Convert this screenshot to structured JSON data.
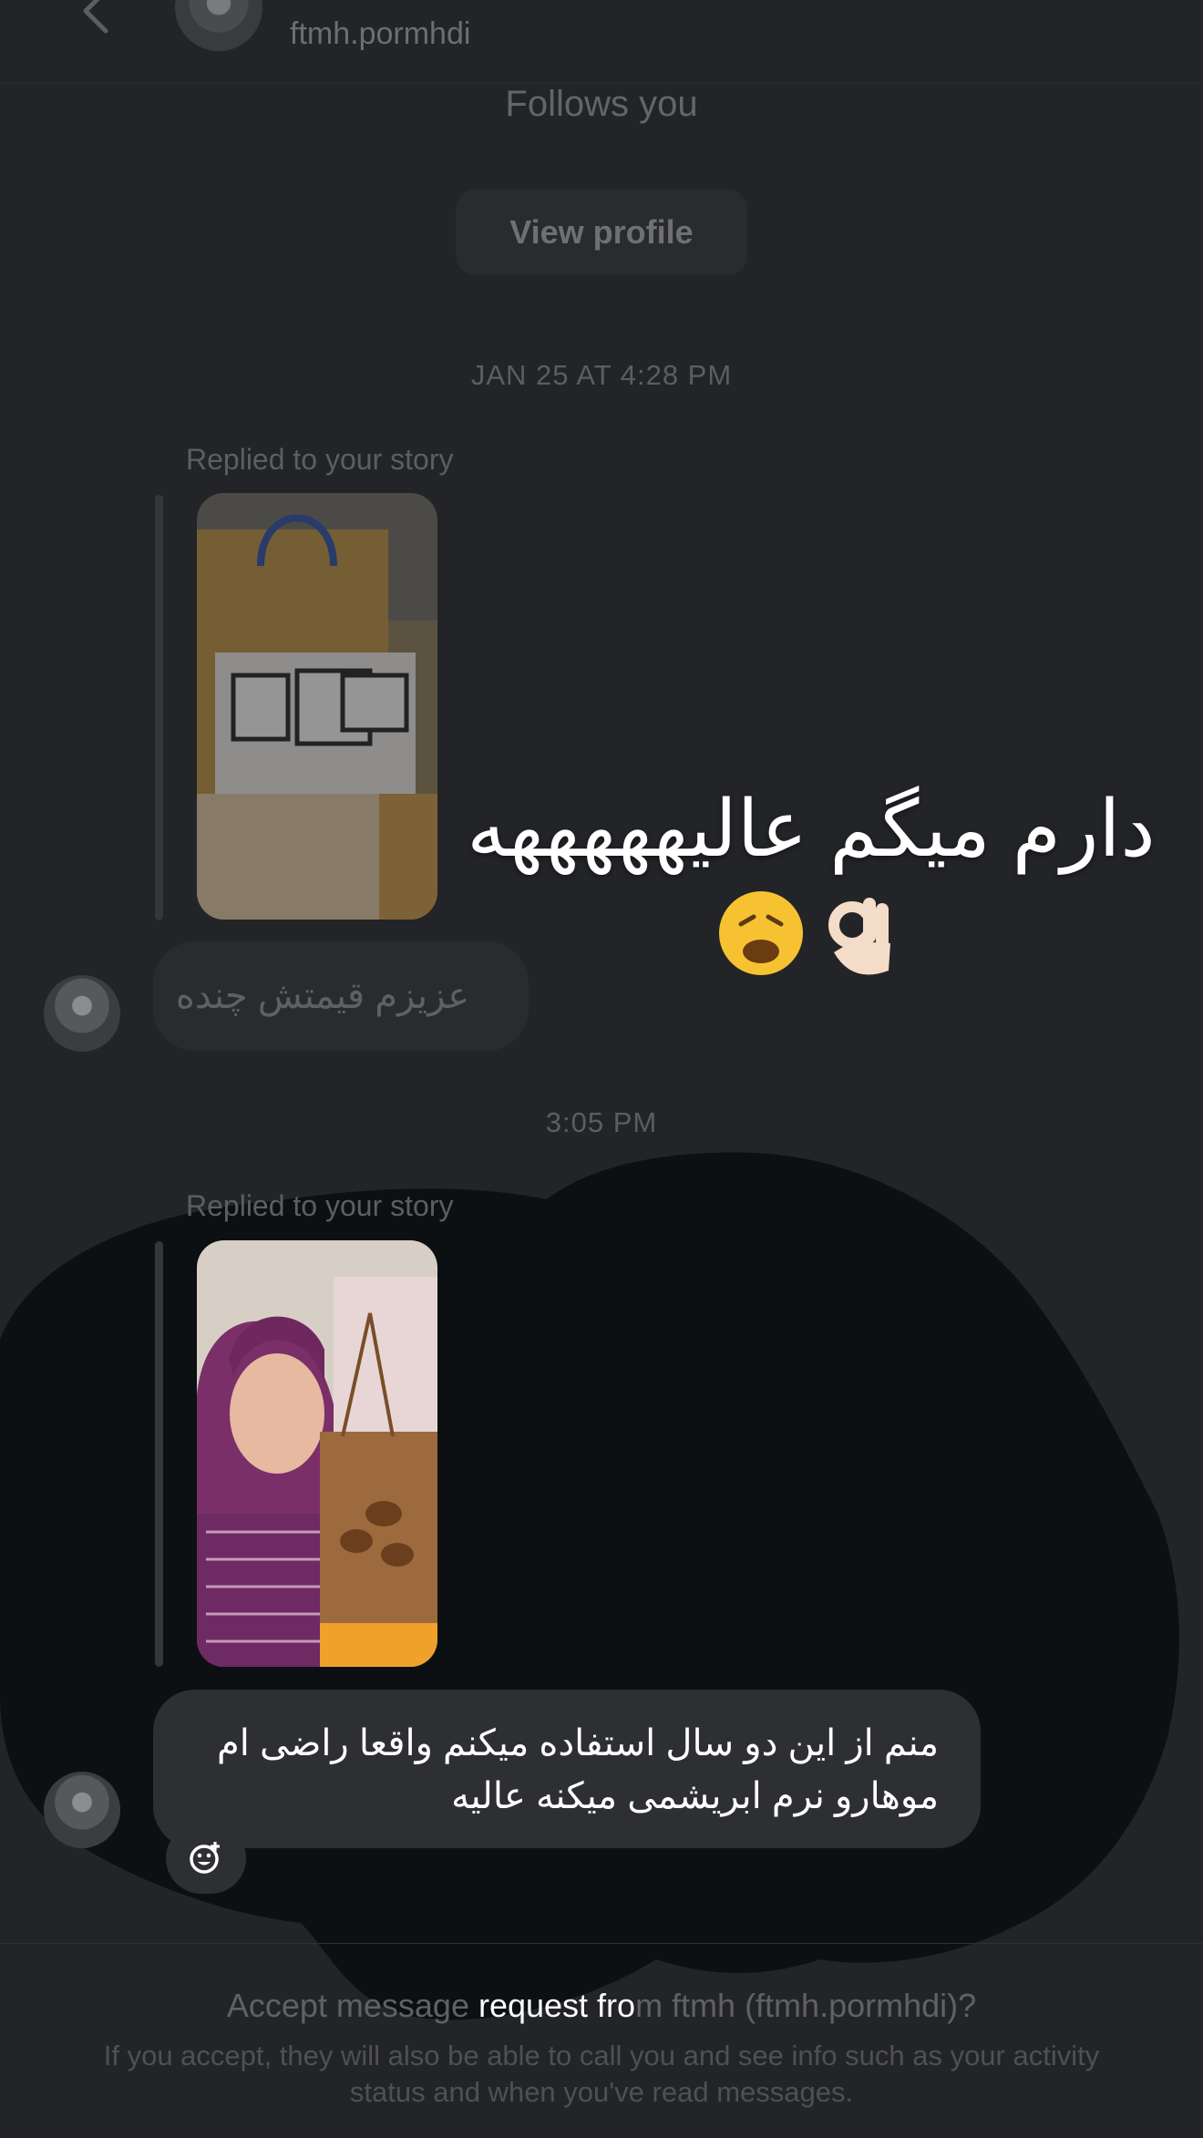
{
  "header": {
    "username": "ftmh.pormhdi",
    "display_name": "ftmh"
  },
  "profile": {
    "follows_label": "Follows you",
    "view_profile_label": "View profile"
  },
  "thread": {
    "timestamp_1": "JAN 25 AT 4:28 PM",
    "replied_label_1": "Replied to your story",
    "story1_text": "دارم میگم عالیهههههه",
    "message_1": "عزیزم قیمتش چنده",
    "timestamp_2": "3:05 PM",
    "replied_label_2": "Replied to your story",
    "message_2": "منم از این دو سال استفاده میکنم واقعا راضی ام موهارو نرم ابریشمی میکنه عالیه"
  },
  "request": {
    "title_prefix": "Accept message ",
    "title_highlight": "request fro",
    "title_suffix": "m ftmh (ftmh.pormhdi)?",
    "body": "If you accept, they will also be able to call you and see info such as your activity status and when you've read messages."
  },
  "colors": {
    "background": "#232428",
    "dark_overlay": "#0c1013",
    "bubble": "#2e2f33"
  }
}
